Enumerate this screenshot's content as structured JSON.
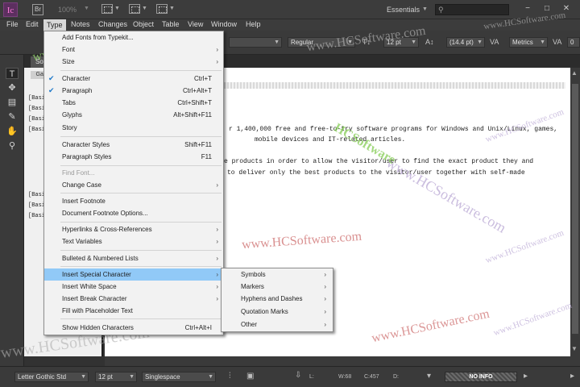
{
  "app": {
    "icon_text": "Ic",
    "bridge_text": "Br",
    "zoom": "100%",
    "workspace": "Essentials",
    "window_controls": [
      "−",
      "□",
      "✕"
    ]
  },
  "menubar": [
    "File",
    "Edit",
    "Type",
    "Notes",
    "Changes",
    "Object",
    "Table",
    "View",
    "Window",
    "Help"
  ],
  "control_panel": {
    "font_style": "Regular",
    "size": "12 pt",
    "leading": "(14.4 pt)",
    "kerning": "Metrics",
    "tracking": "0"
  },
  "document_tab": "Gal",
  "style_panel_tab": "Gal",
  "left_tab": "Sof",
  "basic_labels": [
    "[Basic",
    "[Basic",
    "[Basic",
    "[Basic",
    "[Basic",
    "[Basic",
    "[Basic"
  ],
  "document_text": [
    "r 1,400,000 free and free-to-try software programs for Windows and Unix/Linux, games,",
    "mobile devices and IT-related articles.",
    "e products in order to allow the visitor/user to find the exact product they and",
    "to deliver only the best products to the visitor/user together with self-made"
  ],
  "type_menu": {
    "items": [
      {
        "label": "Add Fonts from Typekit...",
        "shortcut": "",
        "submenu": false,
        "checked": false,
        "disabled": false
      },
      {
        "label": "Font",
        "shortcut": "",
        "submenu": true,
        "checked": false,
        "disabled": false
      },
      {
        "label": "Size",
        "shortcut": "",
        "submenu": true,
        "checked": false,
        "disabled": false
      },
      {
        "label": "Character",
        "shortcut": "Ctrl+T",
        "submenu": false,
        "checked": true,
        "disabled": false
      },
      {
        "label": "Paragraph",
        "shortcut": "Ctrl+Alt+T",
        "submenu": false,
        "checked": true,
        "disabled": false
      },
      {
        "label": "Tabs",
        "shortcut": "Ctrl+Shift+T",
        "submenu": false,
        "checked": false,
        "disabled": false
      },
      {
        "label": "Glyphs",
        "shortcut": "Alt+Shift+F11",
        "submenu": false,
        "checked": false,
        "disabled": false
      },
      {
        "label": "Story",
        "shortcut": "",
        "submenu": false,
        "checked": false,
        "disabled": false
      },
      {
        "label": "Character Styles",
        "shortcut": "Shift+F11",
        "submenu": false,
        "checked": false,
        "disabled": false
      },
      {
        "label": "Paragraph Styles",
        "shortcut": "F11",
        "submenu": false,
        "checked": false,
        "disabled": false
      },
      {
        "label": "Find Font...",
        "shortcut": "",
        "submenu": false,
        "checked": false,
        "disabled": true
      },
      {
        "label": "Change Case",
        "shortcut": "",
        "submenu": true,
        "checked": false,
        "disabled": false
      },
      {
        "label": "Insert Footnote",
        "shortcut": "",
        "submenu": false,
        "checked": false,
        "disabled": false
      },
      {
        "label": "Document Footnote Options...",
        "shortcut": "",
        "submenu": false,
        "checked": false,
        "disabled": false
      },
      {
        "label": "Hyperlinks & Cross-References",
        "shortcut": "",
        "submenu": true,
        "checked": false,
        "disabled": false
      },
      {
        "label": "Text Variables",
        "shortcut": "",
        "submenu": true,
        "checked": false,
        "disabled": false
      },
      {
        "label": "Bulleted & Numbered Lists",
        "shortcut": "",
        "submenu": true,
        "checked": false,
        "disabled": false
      },
      {
        "label": "Insert Special Character",
        "shortcut": "",
        "submenu": true,
        "checked": false,
        "disabled": false,
        "highlighted": true
      },
      {
        "label": "Insert White Space",
        "shortcut": "",
        "submenu": true,
        "checked": false,
        "disabled": false
      },
      {
        "label": "Insert Break Character",
        "shortcut": "",
        "submenu": true,
        "checked": false,
        "disabled": false
      },
      {
        "label": "Fill with Placeholder Text",
        "shortcut": "",
        "submenu": false,
        "checked": false,
        "disabled": false
      },
      {
        "label": "Show Hidden Characters",
        "shortcut": "Ctrl+Alt+I",
        "submenu": false,
        "checked": false,
        "disabled": false
      }
    ]
  },
  "special_char_submenu": [
    "Symbols",
    "Markers",
    "Hyphens and Dashes",
    "Quotation Marks",
    "Other"
  ],
  "status_bar": {
    "font": "Letter Gothic Std",
    "size": "12 pt",
    "spacing": "Singlespace",
    "line_label": "L:",
    "w_label": "W:68",
    "c_label": "C:457",
    "d_label": "D:",
    "info": "NO INFO"
  },
  "watermark": "www.HCSoftware.com",
  "watermark_short": "HCSoftware",
  "colors": {
    "menu_highlight": "#91c9f7",
    "check": "#1b77c8",
    "app_icon": "#ff7ad9"
  }
}
